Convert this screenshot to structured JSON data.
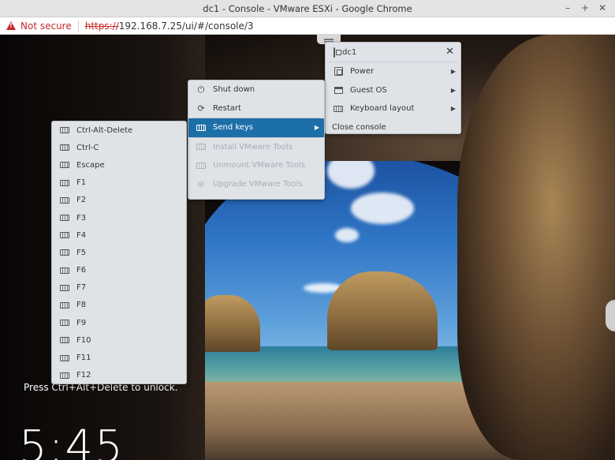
{
  "window": {
    "title": "dc1 - Console - VMware ESXi - Google Chrome",
    "controls": [
      "–",
      "+",
      "✕"
    ]
  },
  "address": {
    "security_label": "Not secure",
    "url_protocol": "https://",
    "url_rest": "192.168.7.25/ui/#/console/3"
  },
  "vm_menu": {
    "title": "dc1",
    "items": [
      {
        "label": "Power",
        "icon": "vm-power-icon",
        "submenu": true
      },
      {
        "label": "Guest OS",
        "icon": "guest-os-icon",
        "submenu": true
      },
      {
        "label": "Keyboard layout",
        "icon": "keyboard-icon",
        "submenu": true
      },
      {
        "label": "Close console",
        "icon": "",
        "submenu": false
      }
    ]
  },
  "guest_menu": {
    "items": [
      {
        "label": "Shut down",
        "icon": "power-icon",
        "state": "normal"
      },
      {
        "label": "Restart",
        "icon": "restart-icon",
        "state": "normal"
      },
      {
        "label": "Send keys",
        "icon": "keyboard-icon",
        "state": "active"
      },
      {
        "label": "Install VMware Tools",
        "icon": "keyboard-icon",
        "state": "disabled"
      },
      {
        "label": "Unmount VMware Tools",
        "icon": "keyboard-icon",
        "state": "disabled"
      },
      {
        "label": "Upgrade VMware Tools",
        "icon": "upgrade-icon",
        "state": "disabled"
      }
    ]
  },
  "keys_menu": {
    "items": [
      "Ctrl-Alt-Delete",
      "Ctrl-C",
      "Escape",
      "F1",
      "F2",
      "F3",
      "F4",
      "F5",
      "F6",
      "F7",
      "F8",
      "F9",
      "F10",
      "F11",
      "F12"
    ]
  },
  "lockscreen": {
    "hint": "Press Ctrl+Alt+Delete to unlock.",
    "time": "5:45"
  },
  "colors": {
    "menu_bg": "#dfe3e8",
    "active_item": "#1d6fa8",
    "warning": "#c62828"
  }
}
